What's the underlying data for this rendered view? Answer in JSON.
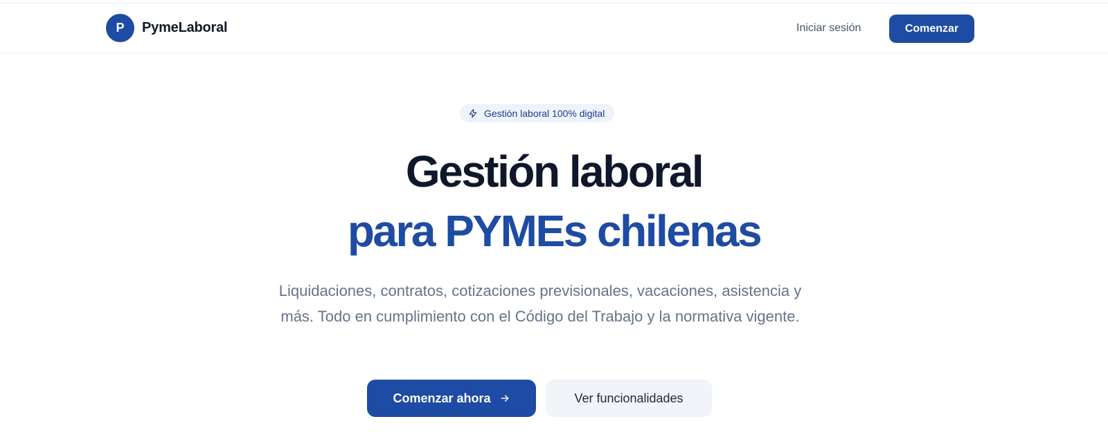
{
  "header": {
    "logo_letter": "P",
    "brand_name": "PymeLaboral",
    "login_label": "Iniciar sesión",
    "cta_label": "Comenzar"
  },
  "hero": {
    "badge_icon": "lightning-bolt-icon",
    "badge_text": "Gestión laboral 100% digital",
    "title_line1": "Gestión laboral",
    "title_line2": "para PYMEs chilenas",
    "subtitle": "Liquidaciones, contratos, cotizaciones previsionales, vacaciones, asistencia y más. Todo en cumplimiento con el Código del Trabajo y la normativa vigente.",
    "primary_button": "Comenzar ahora",
    "primary_button_icon": "arrow-right-icon",
    "secondary_button": "Ver funcionalidades"
  },
  "colors": {
    "brand_blue": "#1e4ba3",
    "heading_dark": "#0f172a",
    "muted_text": "#64748b",
    "badge_bg": "#eef4fc",
    "secondary_button_bg": "#f1f4f8"
  }
}
